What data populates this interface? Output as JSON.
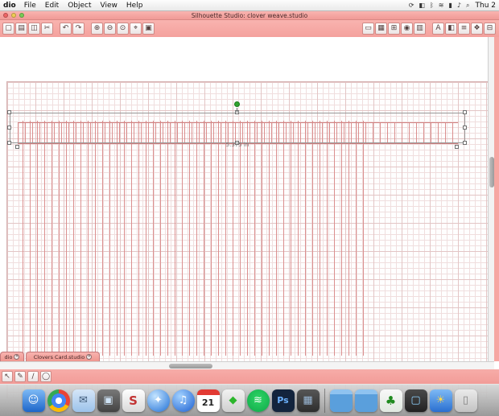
{
  "colors": {
    "chrome_pink": "#f5a09c",
    "grid_minor": "#f0dede",
    "grid_major": "#e3c5c5",
    "stripe_red": "#db8f8f",
    "selection_green": "#2fa32f"
  },
  "menubar": {
    "app_menu": "dio",
    "items": [
      "File",
      "Edit",
      "Object",
      "View",
      "Help"
    ],
    "status_icons": [
      {
        "name": "sync-icon",
        "glyph": "⟳"
      },
      {
        "name": "display-icon",
        "glyph": "◧"
      },
      {
        "name": "bluetooth-icon",
        "glyph": "ᛒ"
      },
      {
        "name": "wifi-icon",
        "glyph": "≋"
      },
      {
        "name": "battery-icon",
        "glyph": "▮"
      },
      {
        "name": "volume-icon",
        "glyph": "♪"
      },
      {
        "name": "spotlight-icon",
        "glyph": "⌕"
      }
    ],
    "clock": "Thu 2"
  },
  "window": {
    "title": "Silhouette Studio: clover weave.studio"
  },
  "toolbar": {
    "left": [
      {
        "name": "new-document-icon",
        "glyph": "▢"
      },
      {
        "name": "open-icon",
        "glyph": "▤"
      },
      {
        "name": "save-icon",
        "glyph": "◫"
      },
      {
        "name": "cut-icon",
        "glyph": "✂"
      },
      {
        "name": "undo-icon",
        "glyph": "↶"
      },
      {
        "name": "redo-icon",
        "glyph": "↷"
      },
      {
        "name": "zoom-in-icon",
        "glyph": "⊕"
      },
      {
        "name": "zoom-out-icon",
        "glyph": "⊖"
      },
      {
        "name": "drag-zoom-icon",
        "glyph": "⊙"
      },
      {
        "name": "pan-icon",
        "glyph": "⌖"
      },
      {
        "name": "fit-to-page-icon",
        "glyph": "▣"
      }
    ],
    "right": [
      {
        "name": "design-page-settings-icon",
        "glyph": "▭"
      },
      {
        "name": "cutting-mat-icon",
        "glyph": "▦"
      },
      {
        "name": "grid-settings-icon",
        "glyph": "⊞"
      },
      {
        "name": "registration-marks-icon",
        "glyph": "◉"
      },
      {
        "name": "print-preview-icon",
        "glyph": "▥"
      },
      {
        "name": "text-style-icon",
        "glyph": "A"
      },
      {
        "name": "fill-settings-icon",
        "glyph": "◧"
      },
      {
        "name": "line-style-icon",
        "glyph": "≡"
      },
      {
        "name": "effects-icon",
        "glyph": "❖"
      },
      {
        "name": "align-icon",
        "glyph": "⊟"
      }
    ]
  },
  "canvas": {
    "measurement": "5.375 in"
  },
  "tabs": [
    {
      "label": "dio",
      "close": "✕"
    },
    {
      "label": "Clovers Card.studio",
      "close": "✕"
    }
  ],
  "bottom_toolbar": [
    {
      "name": "select-tool-icon",
      "glyph": "↖"
    },
    {
      "name": "edit-points-tool-icon",
      "glyph": "✎"
    },
    {
      "name": "draw-line-tool-icon",
      "glyph": "∕"
    },
    {
      "name": "draw-ellipse-tool-icon",
      "glyph": "◯"
    }
  ],
  "dock": {
    "items": [
      {
        "name": "finder",
        "glyph": "☺"
      },
      {
        "name": "chrome",
        "glyph": ""
      },
      {
        "name": "mail",
        "glyph": "✉"
      },
      {
        "name": "preview-app",
        "glyph": "▣"
      },
      {
        "name": "silhouette-studio",
        "glyph": "S"
      },
      {
        "name": "safari",
        "glyph": "✦"
      },
      {
        "name": "itunes",
        "glyph": "♫"
      },
      {
        "name": "calendar",
        "glyph": "21"
      },
      {
        "name": "the-sims",
        "glyph": "◆"
      },
      {
        "name": "spotify",
        "glyph": "≋"
      },
      {
        "name": "photoshop",
        "glyph": "Ps"
      },
      {
        "name": "media-app",
        "glyph": "▦"
      },
      {
        "name": "folder-1",
        "glyph": ""
      },
      {
        "name": "folder-2",
        "glyph": ""
      },
      {
        "name": "shamrock-file",
        "glyph": "♣"
      },
      {
        "name": "tv-app",
        "glyph": "▢"
      },
      {
        "name": "weather-app",
        "glyph": "☀"
      },
      {
        "name": "trash",
        "glyph": "▯"
      }
    ]
  }
}
